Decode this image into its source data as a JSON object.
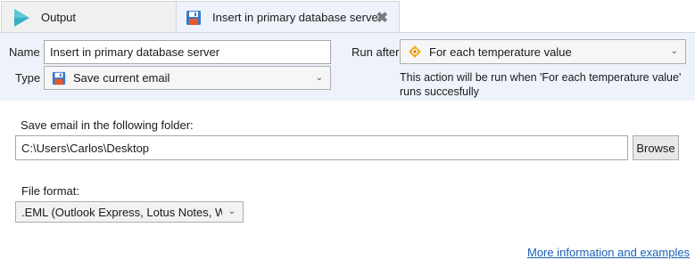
{
  "tabs": [
    {
      "label": "Output",
      "icon": "play-icon"
    },
    {
      "label": "Insert in primary database server",
      "icon": "save-email-icon"
    }
  ],
  "config": {
    "name_label": "Name",
    "name_value": "Insert in primary database server",
    "type_label": "Type",
    "type_value": "Save current email",
    "run_after_label": "Run after",
    "run_after_value": "For each temperature value",
    "run_after_hint": "This action will be run when 'For each temperature value' runs succesfully"
  },
  "folder": {
    "label": "Save email in the following folder:",
    "value": "C:\\Users\\Carlos\\Desktop",
    "browse_label": "Browse"
  },
  "format": {
    "label": "File format:",
    "value": ".EML (Outlook Express, Lotus Notes, Wind…"
  },
  "more_info_link": "More information and examples",
  "colors": {
    "panel_bg": "#eef3fb",
    "link": "#1a5fb4",
    "play_icon": "#33b0c4",
    "loop_icon": "#e8a317"
  }
}
